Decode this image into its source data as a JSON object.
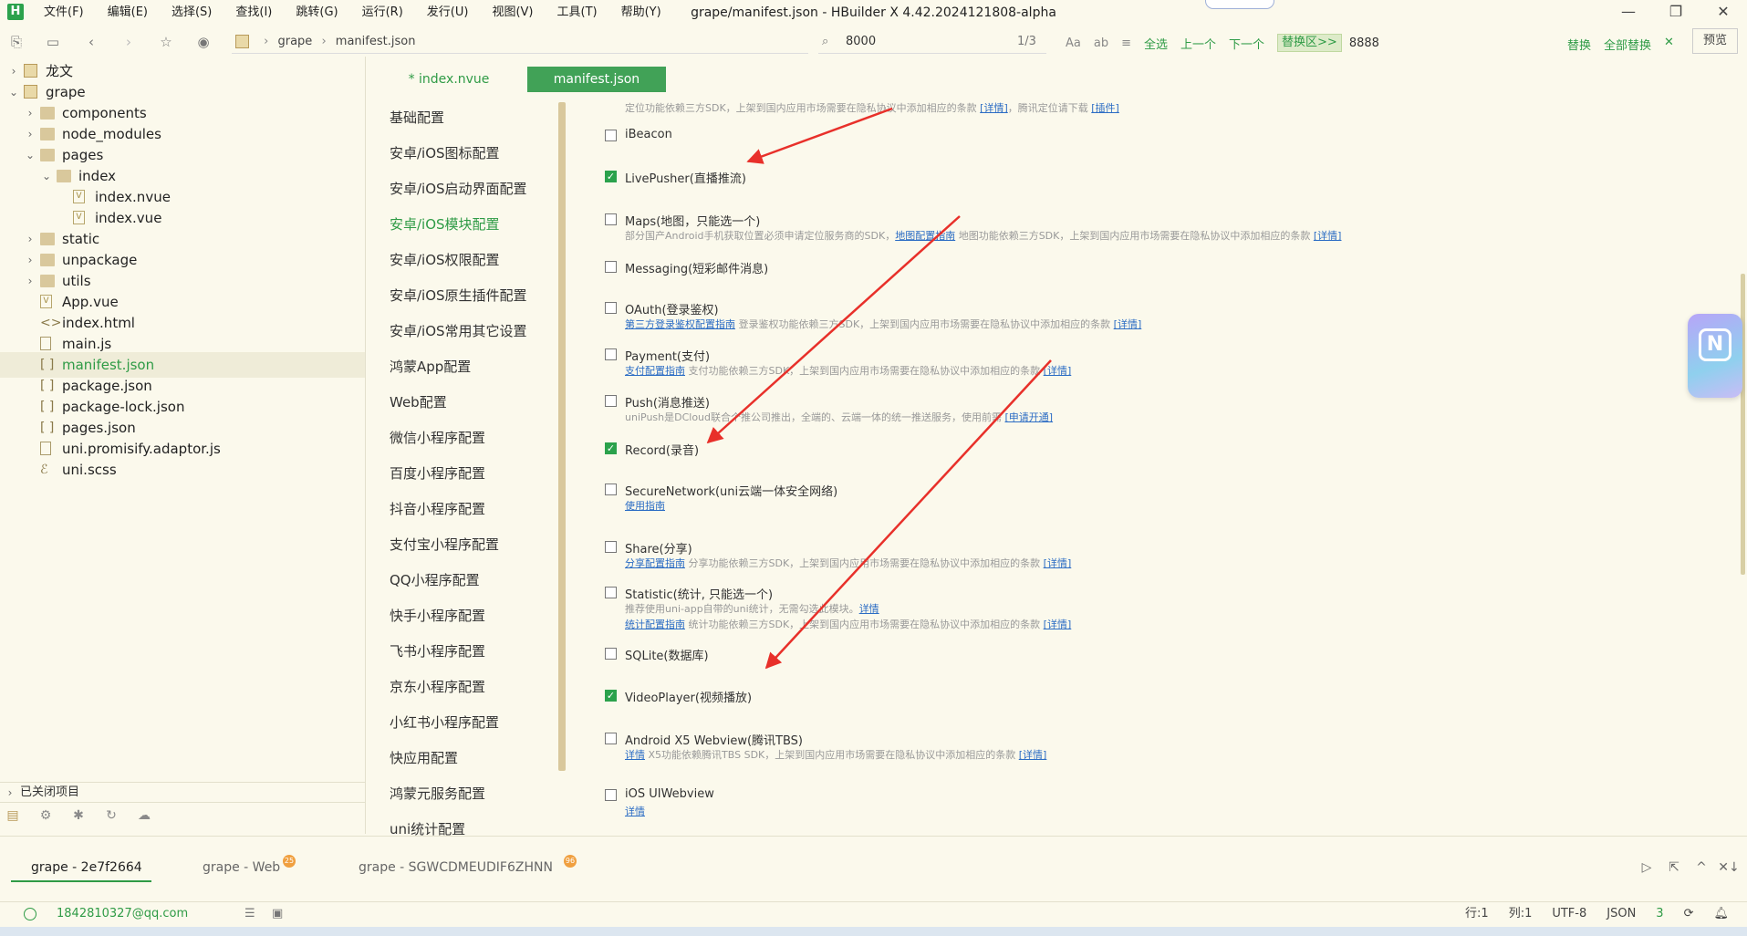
{
  "app": {
    "logo": "H",
    "title": "grape/manifest.json - HBuilder X 4.42.2024121808-alpha",
    "menu": [
      "文件(F)",
      "编辑(E)",
      "选择(S)",
      "查找(I)",
      "跳转(G)",
      "运行(R)",
      "发行(U)",
      "视图(V)",
      "工具(T)",
      "帮助(Y)"
    ],
    "win_controls": [
      "—",
      "❐",
      "✕"
    ]
  },
  "toolbar": {
    "breadcrumb": [
      "grape",
      "manifest.json"
    ],
    "find": {
      "value": "8000",
      "count": "1/3"
    },
    "find_tools": [
      "Aa",
      "ab",
      "全选",
      "上一个",
      "下一个"
    ],
    "replace_toggle": "替换区>>",
    "replace_value": "8888",
    "replace_actions": [
      "替换",
      "全部替换"
    ],
    "preview": "预览"
  },
  "explorer": {
    "items": [
      {
        "label": "龙文",
        "type": "project",
        "depth": 0,
        "chevron": "›"
      },
      {
        "label": "grape",
        "type": "project",
        "depth": 0,
        "chevron": "⌄"
      },
      {
        "label": "components",
        "type": "folder",
        "depth": 1,
        "chevron": "›"
      },
      {
        "label": "node_modules",
        "type": "folder",
        "depth": 1,
        "chevron": "›"
      },
      {
        "label": "pages",
        "type": "folder",
        "depth": 1,
        "chevron": "⌄"
      },
      {
        "label": "index",
        "type": "folder",
        "depth": 2,
        "chevron": "⌄"
      },
      {
        "label": "index.nvue",
        "type": "vue",
        "depth": 3,
        "chevron": ""
      },
      {
        "label": "index.vue",
        "type": "vue",
        "depth": 3,
        "chevron": ""
      },
      {
        "label": "static",
        "type": "folder",
        "depth": 1,
        "chevron": "›"
      },
      {
        "label": "unpackage",
        "type": "folder",
        "depth": 1,
        "chevron": "›"
      },
      {
        "label": "utils",
        "type": "folder",
        "depth": 1,
        "chevron": "›"
      },
      {
        "label": "App.vue",
        "type": "vue",
        "depth": 1,
        "chevron": ""
      },
      {
        "label": "index.html",
        "type": "html",
        "depth": 1,
        "chevron": ""
      },
      {
        "label": "main.js",
        "type": "file",
        "depth": 1,
        "chevron": ""
      },
      {
        "label": "manifest.json",
        "type": "json-config",
        "depth": 1,
        "chevron": "",
        "active": true
      },
      {
        "label": "package.json",
        "type": "json",
        "depth": 1,
        "chevron": ""
      },
      {
        "label": "package-lock.json",
        "type": "json",
        "depth": 1,
        "chevron": ""
      },
      {
        "label": "pages.json",
        "type": "json",
        "depth": 1,
        "chevron": ""
      },
      {
        "label": "uni.promisify.adaptor.js",
        "type": "file",
        "depth": 1,
        "chevron": ""
      },
      {
        "label": "uni.scss",
        "type": "scss",
        "depth": 1,
        "chevron": ""
      }
    ],
    "closed_projects": "已关闭项目"
  },
  "editor_tabs": {
    "index": "* index.nvue",
    "manifest": "manifest.json"
  },
  "settings_nav": [
    {
      "label": "基础配置"
    },
    {
      "label": "安卓/iOS图标配置"
    },
    {
      "label": "安卓/iOS启动界面配置"
    },
    {
      "label": "安卓/iOS模块配置",
      "active": true
    },
    {
      "label": "安卓/iOS权限配置"
    },
    {
      "label": "安卓/iOS原生插件配置"
    },
    {
      "label": "安卓/iOS常用其它设置"
    },
    {
      "label": "鸿蒙App配置"
    },
    {
      "label": "Web配置"
    },
    {
      "label": "微信小程序配置"
    },
    {
      "label": "百度小程序配置"
    },
    {
      "label": "抖音小程序配置"
    },
    {
      "label": "支付宝小程序配置"
    },
    {
      "label": "QQ小程序配置"
    },
    {
      "label": "快手小程序配置"
    },
    {
      "label": "飞书小程序配置"
    },
    {
      "label": "京东小程序配置"
    },
    {
      "label": "小红书小程序配置"
    },
    {
      "label": "快应用配置"
    },
    {
      "label": "鸿蒙元服务配置"
    },
    {
      "label": "uni统计配置"
    }
  ],
  "content": {
    "top_desc": {
      "text": "定位功能依赖三方SDK，上架到国内应用市场需要在隐私协议中添加相应的条款",
      "link1": "[详情]",
      "mid": "，腾讯定位请下载",
      "link2": "[插件]"
    },
    "options": [
      {
        "label": "iBeacon",
        "checked": false,
        "desc": []
      },
      {
        "label": "LivePusher(直播推流)",
        "checked": true,
        "desc": []
      },
      {
        "label": "Maps(地图，只能选一个)",
        "checked": false,
        "desc": [
          {
            "text": "部分国产Android手机获取位置必须申请定位服务商的SDK，",
            "link": "地图配置指南",
            "tail": " 地图功能依赖三方SDK，上架到国内应用市场需要在隐私协议中添加相应的条款 ",
            "link2": "[详情]"
          }
        ]
      },
      {
        "label": "Messaging(短彩邮件消息)",
        "checked": false,
        "desc": []
      },
      {
        "label": "OAuth(登录鉴权)",
        "checked": false,
        "desc": [
          {
            "lead_link": "第三方登录鉴权配置指南",
            "text": " 登录鉴权功能依赖三方SDK，上架到国内应用市场需要在隐私协议中添加相应的条款 ",
            "link2": "[详情]"
          }
        ]
      },
      {
        "label": "Payment(支付)",
        "checked": false,
        "desc": [
          {
            "lead_link": "支付配置指南",
            "text": " 支付功能依赖三方SDK，上架到国内应用市场需要在隐私协议中添加相应的条款 ",
            "link2": "[详情]"
          }
        ]
      },
      {
        "label": "Push(消息推送)",
        "checked": false,
        "desc": [
          {
            "text": "uniPush是DCloud联合个推公司推出，全端的、云端一体的统一推送服务，使用前需 ",
            "link2": "[申请开通]"
          }
        ]
      },
      {
        "label": "Record(录音)",
        "checked": true,
        "desc": []
      },
      {
        "label": "SecureNetwork(uni云端一体安全网络)",
        "checked": false,
        "desc": [
          {
            "lead_link": "使用指南",
            "text": "",
            "link2": ""
          }
        ]
      },
      {
        "label": "Share(分享)",
        "checked": false,
        "desc": [
          {
            "lead_link": "分享配置指南",
            "text": " 分享功能依赖三方SDK，上架到国内应用市场需要在隐私协议中添加相应的条款 ",
            "link2": "[详情]"
          }
        ]
      },
      {
        "label": "Statistic(统计, 只能选一个)",
        "checked": false,
        "desc": [
          {
            "text": "推荐使用uni-app自带的uni统计，无需勾选此模块。",
            "link2": "详情"
          },
          {
            "lead_link": "统计配置指南",
            "text": " 统计功能依赖三方SDK，上架到国内应用市场需要在隐私协议中添加相应的条款 ",
            "link2": "[详情]"
          }
        ]
      },
      {
        "label": "SQLite(数据库)",
        "checked": false,
        "desc": []
      },
      {
        "label": "VideoPlayer(视频播放)",
        "checked": true,
        "desc": []
      },
      {
        "label": "Android X5 Webview(腾讯TBS)",
        "checked": false,
        "desc": [
          {
            "lead_link": "详情",
            "text": " X5功能依赖腾讯TBS SDK，上架到国内应用市场需要在隐私协议中添加相应的条款 ",
            "link2": "[详情]"
          }
        ]
      },
      {
        "label": "iOS UIWebview",
        "checked": false,
        "desc": [
          {
            "lead_link": "详情",
            "text": "",
            "link2": ""
          }
        ]
      }
    ]
  },
  "bottom_tabs": [
    {
      "label": "grape - 2e7f2664",
      "active": true,
      "badge": ""
    },
    {
      "label": "grape - Web",
      "active": false,
      "badge": "25"
    },
    {
      "label": "grape - SGWCDMEUDIF6ZHNN",
      "active": false,
      "badge": "96"
    }
  ],
  "bottom_controls": [
    "▷",
    "⇱",
    "^",
    "✕↓"
  ],
  "statusbar": {
    "user": "1842810327@qq.com",
    "line": "行:1",
    "col": "列:1",
    "encoding": "UTF-8",
    "lang": "JSON",
    "count": "3"
  },
  "colors": {
    "accent": "#2f9b46",
    "background": "#fbf9ec",
    "active_tab": "#41a257",
    "link": "#2b6cc4",
    "annotation_arrow": "#e8302a"
  }
}
